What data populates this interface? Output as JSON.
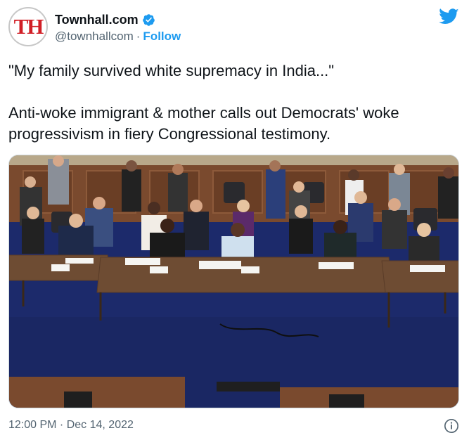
{
  "account": {
    "avatar_text": "TH",
    "display_name": "Townhall.com",
    "handle": "@townhallcom",
    "separator": "·",
    "follow_label": "Follow"
  },
  "tweet": {
    "line1": "\"My family survived white supremacy in India...\"",
    "line2": "Anti-woke immigrant & mother calls out Democrats' woke progressivism in fiery Congressional testimony."
  },
  "footer": {
    "timestamp": "12:00 PM · Dec 14, 2022"
  },
  "colors": {
    "brand_red": "#d11f26",
    "twitter_blue": "#1d9bf0",
    "verified_blue": "#1d9bf0",
    "muted_text": "#536471"
  },
  "icons": [
    "verified-badge-icon",
    "twitter-bird-icon",
    "info-icon"
  ]
}
